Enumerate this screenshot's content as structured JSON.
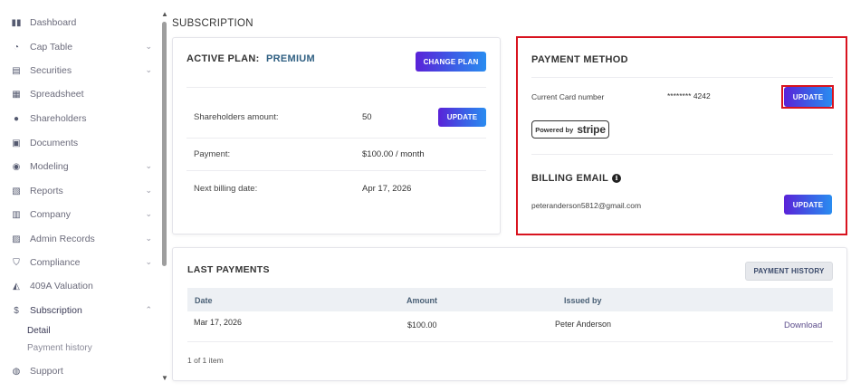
{
  "sidebar": {
    "items": [
      {
        "label": "Dashboard",
        "icon": "dashboard-icon",
        "glyph": "▮▮",
        "chevron": false
      },
      {
        "label": "Cap Table",
        "icon": "pie-chart-icon",
        "glyph": "◔",
        "chevron": true
      },
      {
        "label": "Securities",
        "icon": "securities-icon",
        "glyph": "▤",
        "chevron": true
      },
      {
        "label": "Spreadsheet",
        "icon": "spreadsheet-icon",
        "glyph": "▦",
        "chevron": false
      },
      {
        "label": "Shareholders",
        "icon": "person-icon",
        "glyph": "●",
        "chevron": false
      },
      {
        "label": "Documents",
        "icon": "documents-icon",
        "glyph": "▣",
        "chevron": false
      },
      {
        "label": "Modeling",
        "icon": "lightbulb-icon",
        "glyph": "◉",
        "chevron": true
      },
      {
        "label": "Reports",
        "icon": "reports-icon",
        "glyph": "▧",
        "chevron": true
      },
      {
        "label": "Company",
        "icon": "building-icon",
        "glyph": "▥",
        "chevron": true
      },
      {
        "label": "Admin Records",
        "icon": "admin-records-icon",
        "glyph": "▨",
        "chevron": true
      },
      {
        "label": "Compliance",
        "icon": "shield-icon",
        "glyph": "⛉",
        "chevron": true
      },
      {
        "label": "409A Valuation",
        "icon": "valuation-icon",
        "glyph": "◭",
        "chevron": false
      },
      {
        "label": "Subscription",
        "icon": "dollar-icon",
        "glyph": "$",
        "chevron": true,
        "expanded": true
      },
      {
        "label": "Support",
        "icon": "support-icon",
        "glyph": "◍",
        "chevron": false
      }
    ],
    "sub_items": [
      "Detail",
      "Payment history"
    ],
    "chevron_down": "⌄",
    "chevron_up": "⌃"
  },
  "scroll": {
    "up": "▲",
    "down": "▼"
  },
  "page": {
    "title": "SUBSCRIPTION"
  },
  "plan": {
    "label": "ACTIVE PLAN:",
    "name": "PREMIUM",
    "change_button": "CHANGE PLAN",
    "rows": [
      {
        "label": "Shareholders amount:",
        "value": "50",
        "button": "UPDATE"
      },
      {
        "label": "Payment:",
        "value": "$100.00 / month"
      },
      {
        "label": "Next billing date:",
        "value": "Apr 17, 2026"
      }
    ]
  },
  "payment_method": {
    "title": "PAYMENT METHOD",
    "card_label": "Current Card number",
    "card_value": "******** 4242",
    "update_button": "UPDATE",
    "badge_small": "Powered by",
    "badge_big": "stripe"
  },
  "billing_email": {
    "title": "BILLING EMAIL",
    "info_glyph": "i",
    "email": "peteranderson5812@gmail.com",
    "update_button": "UPDATE"
  },
  "last_payments": {
    "title": "LAST PAYMENTS",
    "history_button": "PAYMENT HISTORY",
    "columns": [
      "Date",
      "Amount",
      "Issued by"
    ],
    "rows": [
      {
        "date": "Mar 17, 2026",
        "amount": "$100.00",
        "issued_by": "Peter Anderson",
        "action": "Download"
      }
    ],
    "pagination": "1 of 1 item"
  },
  "colors": {
    "accent_gradient_start": "#5a22d8",
    "accent_gradient_end": "#2a8cf0",
    "plan_name": "#2f5f82",
    "highlight": "#d8131f",
    "link": "#5d4e8c"
  }
}
